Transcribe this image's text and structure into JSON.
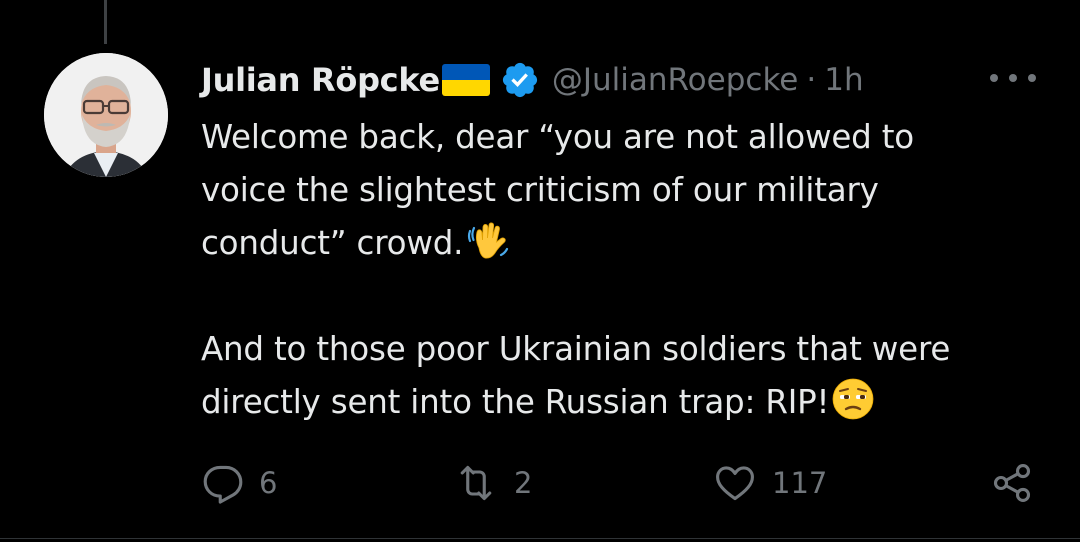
{
  "tweet": {
    "author": {
      "display_name": "Julian Röpcke",
      "handle": "@JulianRoepcke",
      "flag": "ukraine-flag-icon",
      "verified": true
    },
    "dot": "·",
    "time": "1h",
    "text": {
      "line1": "Welcome back, dear “you are not allowed to",
      "line2": "voice the slightest criticism of our military",
      "line3": "conduct” crowd.",
      "line4": "And to those poor Ukrainian soldiers that were",
      "line5": "directly sent into the Russian trap: RIP!"
    },
    "emojis": [
      "waving-hand-icon",
      "unamused-face-icon"
    ],
    "stats": {
      "replies": "6",
      "reposts": "2",
      "likes": "117"
    }
  },
  "colors": {
    "background": "#000000",
    "text": "#e7e9ea",
    "secondary": "#71767b",
    "verified": "#1d9bf0",
    "flag_blue": "#0057b7",
    "flag_yellow": "#ffd700"
  }
}
